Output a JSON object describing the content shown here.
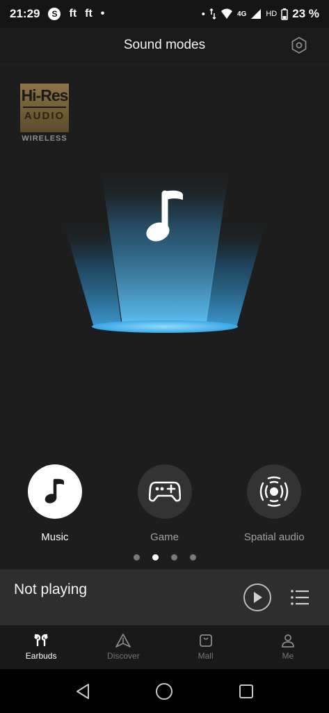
{
  "status_bar": {
    "time": "21:29",
    "left_icons": [
      "S",
      "ft",
      "ft",
      "•"
    ],
    "network": "4G",
    "hd": "HD",
    "battery": "23 %"
  },
  "header": {
    "title": "Sound modes",
    "settings_icon": "hexagon-settings-icon"
  },
  "badge": {
    "name": "Hi-Res",
    "audio": "AUDIO",
    "wireless": "WIRELESS"
  },
  "modes": [
    {
      "label": "Music",
      "icon": "music-note-icon",
      "active": true
    },
    {
      "label": "Game",
      "icon": "gamepad-icon",
      "active": false
    },
    {
      "label": "Spatial audio",
      "icon": "spatial-audio-icon",
      "active": false
    }
  ],
  "pager": {
    "count": 4,
    "active_index": 1
  },
  "player": {
    "status": "Not playing",
    "play_icon": "play-icon",
    "queue_icon": "playlist-icon"
  },
  "nav": [
    {
      "label": "Earbuds",
      "icon": "earbuds-icon",
      "active": true
    },
    {
      "label": "Discover",
      "icon": "discover-icon",
      "active": false
    },
    {
      "label": "Mall",
      "icon": "bag-icon",
      "active": false
    },
    {
      "label": "Me",
      "icon": "person-icon",
      "active": false
    }
  ],
  "colors": {
    "accent_light": "#5ec6ff",
    "accent_deep": "#1f6e9e",
    "background": "#1d1d1d",
    "active_mode": "#ffffff"
  }
}
